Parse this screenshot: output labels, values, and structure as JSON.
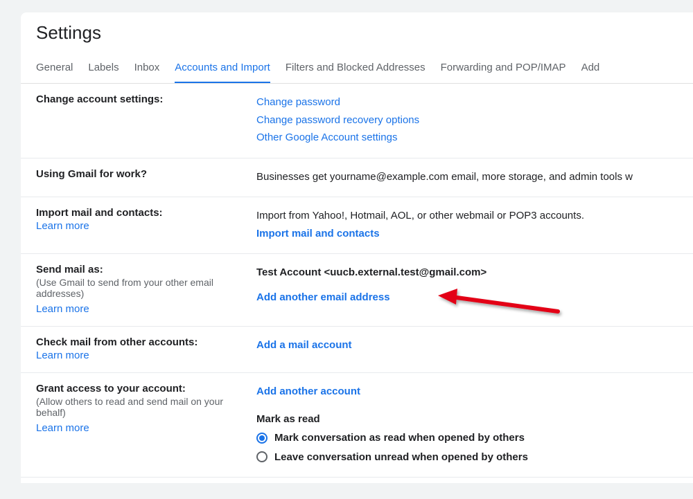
{
  "page_title": "Settings",
  "tabs": {
    "general": "General",
    "labels": "Labels",
    "inbox": "Inbox",
    "accounts": "Accounts and Import",
    "filters": "Filters and Blocked Addresses",
    "forwarding": "Forwarding and POP/IMAP",
    "addons": "Add"
  },
  "sections": {
    "change_account": {
      "title": "Change account settings:",
      "links": {
        "change_password": "Change password",
        "recovery": "Change password recovery options",
        "other": "Other Google Account settings"
      }
    },
    "using_for_work": {
      "title": "Using Gmail for work?",
      "text": "Businesses get yourname@example.com email, more storage, and admin tools w"
    },
    "import_mail": {
      "title": "Import mail and contacts:",
      "learn_more": "Learn more",
      "text": "Import from Yahoo!, Hotmail, AOL, or other webmail or POP3 accounts.",
      "action": "Import mail and contacts"
    },
    "send_mail_as": {
      "title": "Send mail as:",
      "sub": "(Use Gmail to send from your other email addresses)",
      "learn_more": "Learn more",
      "account": "Test Account <uucb.external.test@gmail.com>",
      "action": "Add another email address"
    },
    "check_mail": {
      "title": "Check mail from other accounts:",
      "learn_more": "Learn more",
      "action": "Add a mail account"
    },
    "grant_access": {
      "title": "Grant access to your account:",
      "sub": "(Allow others to read and send mail on your behalf)",
      "learn_more": "Learn more",
      "action": "Add another account",
      "mark_as_read_label": "Mark as read",
      "radio1": "Mark conversation as read when opened by others",
      "radio2": "Leave conversation unread when opened by others"
    }
  }
}
